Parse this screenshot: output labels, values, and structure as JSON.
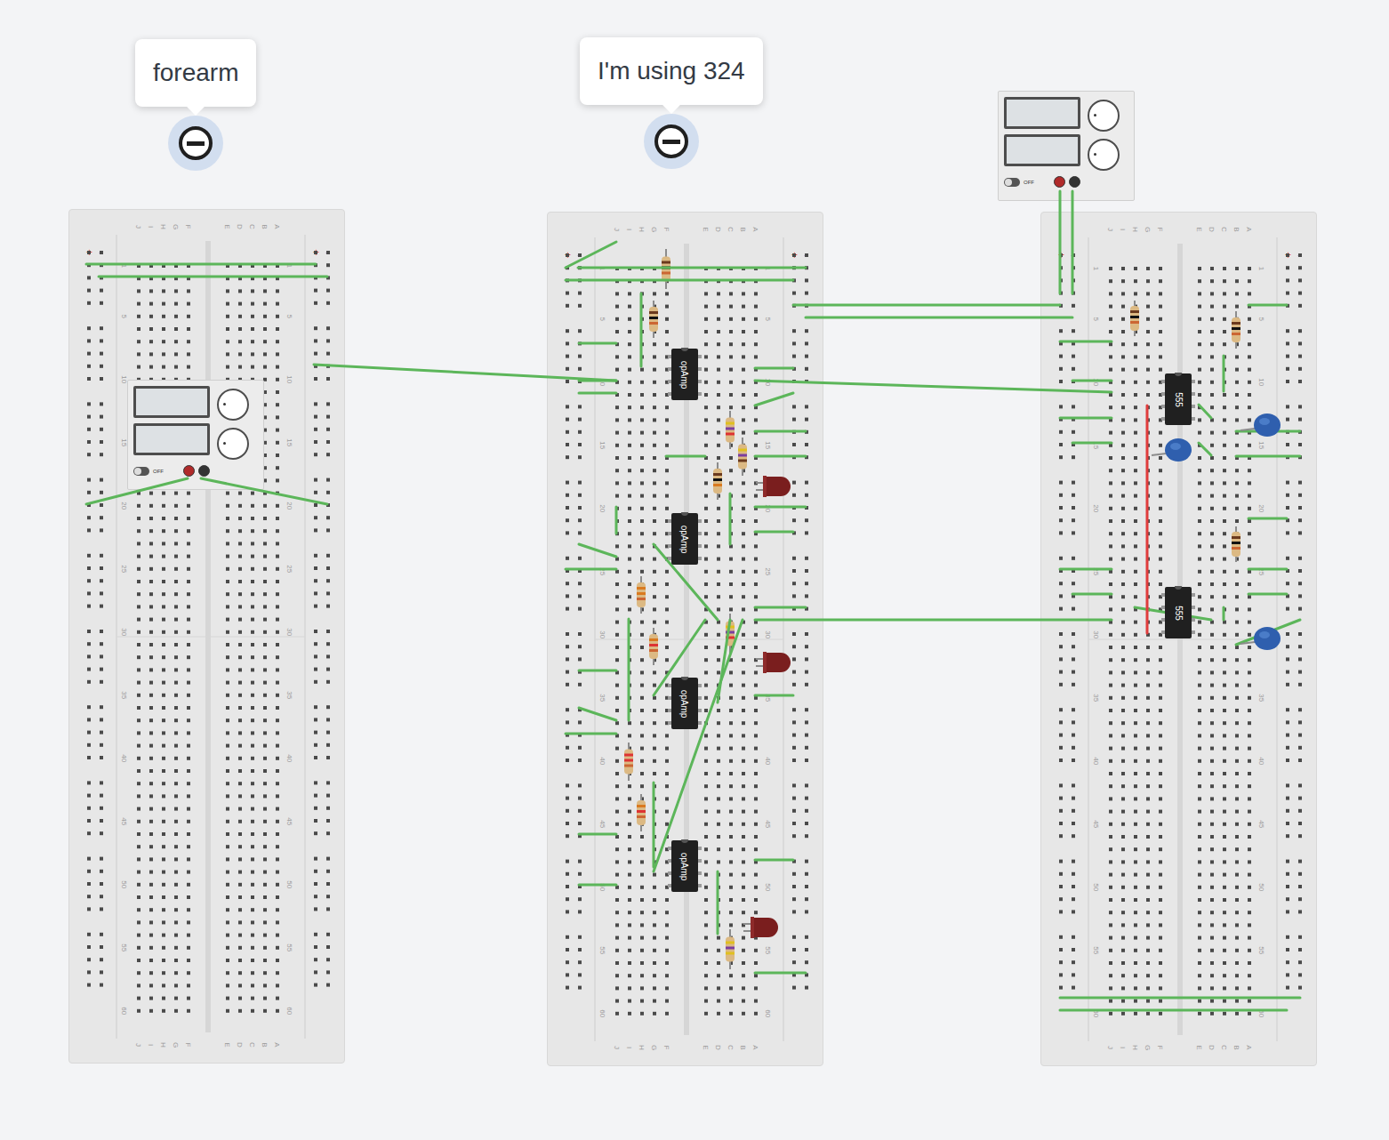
{
  "notes": [
    {
      "text": "forearm"
    },
    {
      "text": "I'm using 324"
    }
  ],
  "breadboard_labels": {
    "columns": [
      "J",
      "I",
      "H",
      "G",
      "F",
      "E",
      "D",
      "C",
      "B",
      "A"
    ],
    "rows": [
      "1",
      "5",
      "10",
      "15",
      "20",
      "25",
      "30",
      "35",
      "40",
      "45",
      "50",
      "55",
      "60"
    ],
    "rails": [
      {
        "label": "+",
        "color": "#e0523f"
      },
      {
        "label": "-",
        "color": "#4a8fd6"
      }
    ]
  },
  "breadboards": [
    {
      "chips": []
    },
    {
      "chips": [
        {
          "label": "opAmp"
        },
        {
          "label": "opAmp"
        },
        {
          "label": "opAmp"
        },
        {
          "label": "opAmp"
        }
      ]
    },
    {
      "chips": [
        {
          "label": "555"
        },
        {
          "label": "555"
        }
      ]
    }
  ],
  "power_supplies": [
    {
      "switch_label": "OFF",
      "on": false
    },
    {
      "switch_label": "OFF",
      "on": false
    }
  ]
}
